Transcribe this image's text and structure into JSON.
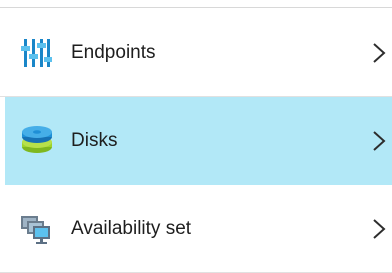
{
  "menu": {
    "items": [
      {
        "label": "Endpoints",
        "icon": "endpoints-icon",
        "selected": false
      },
      {
        "label": "Disks",
        "icon": "disks-icon",
        "selected": true
      },
      {
        "label": "Availability set",
        "icon": "availability-set-icon",
        "selected": false
      }
    ],
    "chevron_icon": "chevron-right-icon"
  },
  "colors": {
    "selected_background": "#b2e8f7",
    "text": "#1e1e1e",
    "separator": "#e1e1e1",
    "chevron": "#2d2d2d",
    "disk_blue": "#1e8fd6",
    "disk_green": "#9ed42a"
  }
}
